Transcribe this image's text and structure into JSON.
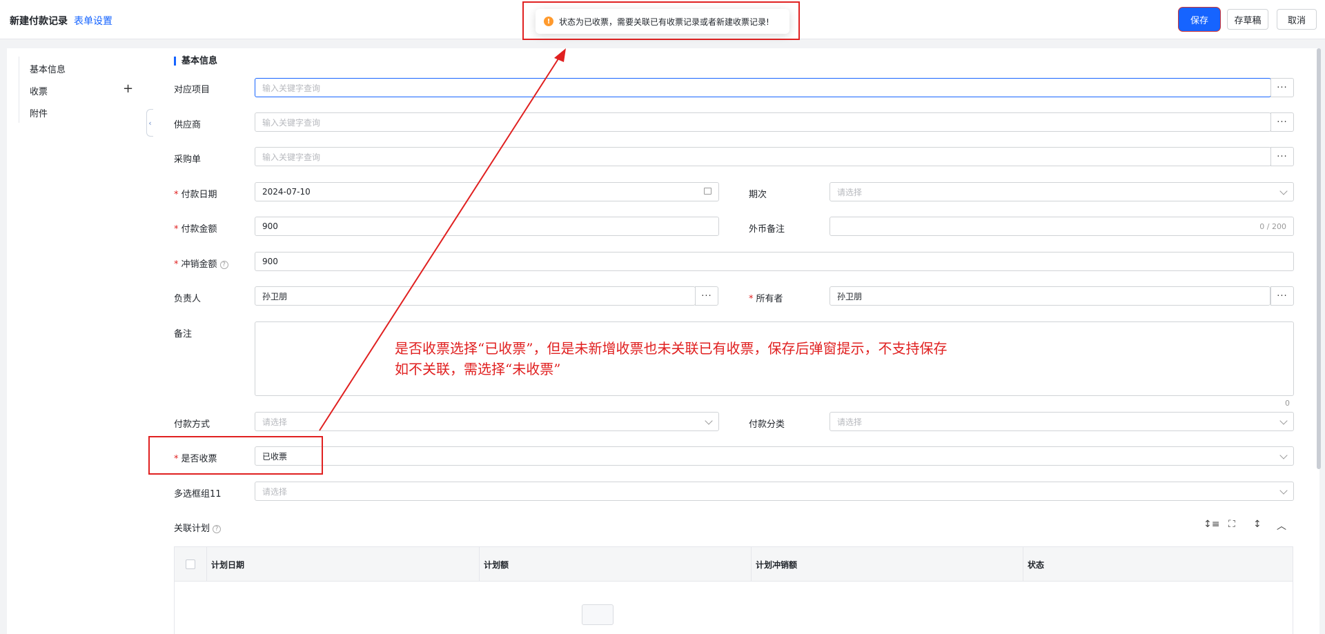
{
  "header": {
    "title": "新建付款记录",
    "form_settings": "表单设置",
    "save": "保存",
    "draft": "存草稿",
    "cancel": "取消"
  },
  "toast": {
    "icon": "warning-icon",
    "message": "状态为已收票，需要关联已有收票记录或者新建收票记录!"
  },
  "sidebar": {
    "items": [
      "基本信息",
      "收票",
      "附件"
    ]
  },
  "section_title": "基本信息",
  "form": {
    "project": {
      "label": "对应项目",
      "placeholder": "输入关键字查询"
    },
    "supplier": {
      "label": "供应商",
      "placeholder": "输入关键字查询"
    },
    "purchase_order": {
      "label": "采购单",
      "placeholder": "输入关键字查询"
    },
    "pay_date": {
      "label": "付款日期",
      "value": "2024-07-10"
    },
    "period": {
      "label": "期次",
      "placeholder": "请选择"
    },
    "pay_amount": {
      "label": "付款金额",
      "value": "900"
    },
    "fx_note": {
      "label": "外币备注",
      "counter": "0 / 200"
    },
    "offset_amount": {
      "label": "冲销金额",
      "value": "900"
    },
    "owner_person": {
      "label": "负责人",
      "value": "孙卫朋"
    },
    "holder": {
      "label": "所有者",
      "value": "孙卫朋"
    },
    "remark": {
      "label": "备注",
      "counter": "0"
    },
    "pay_method": {
      "label": "付款方式",
      "placeholder": "请选择"
    },
    "pay_category": {
      "label": "付款分类",
      "placeholder": "请选择"
    },
    "invoice_received": {
      "label": "是否收票",
      "value": "已收票"
    },
    "multi_group": {
      "label": "多选框组11",
      "placeholder": "请选择"
    },
    "related_plan": {
      "label": "关联计划"
    }
  },
  "annotation": {
    "line1": "是否收票选择“已收票”，但是未新增收票也未关联已有收票，保存后弹窗提示，不支持保存",
    "line2": "如不关联，需选择“未收票”"
  },
  "table": {
    "columns": [
      "计划日期",
      "计划额",
      "计划冲销额",
      "状态"
    ]
  },
  "colors": {
    "accent": "#1664ff",
    "annotation_red": "#e02020",
    "warning": "#ff9a2e"
  }
}
